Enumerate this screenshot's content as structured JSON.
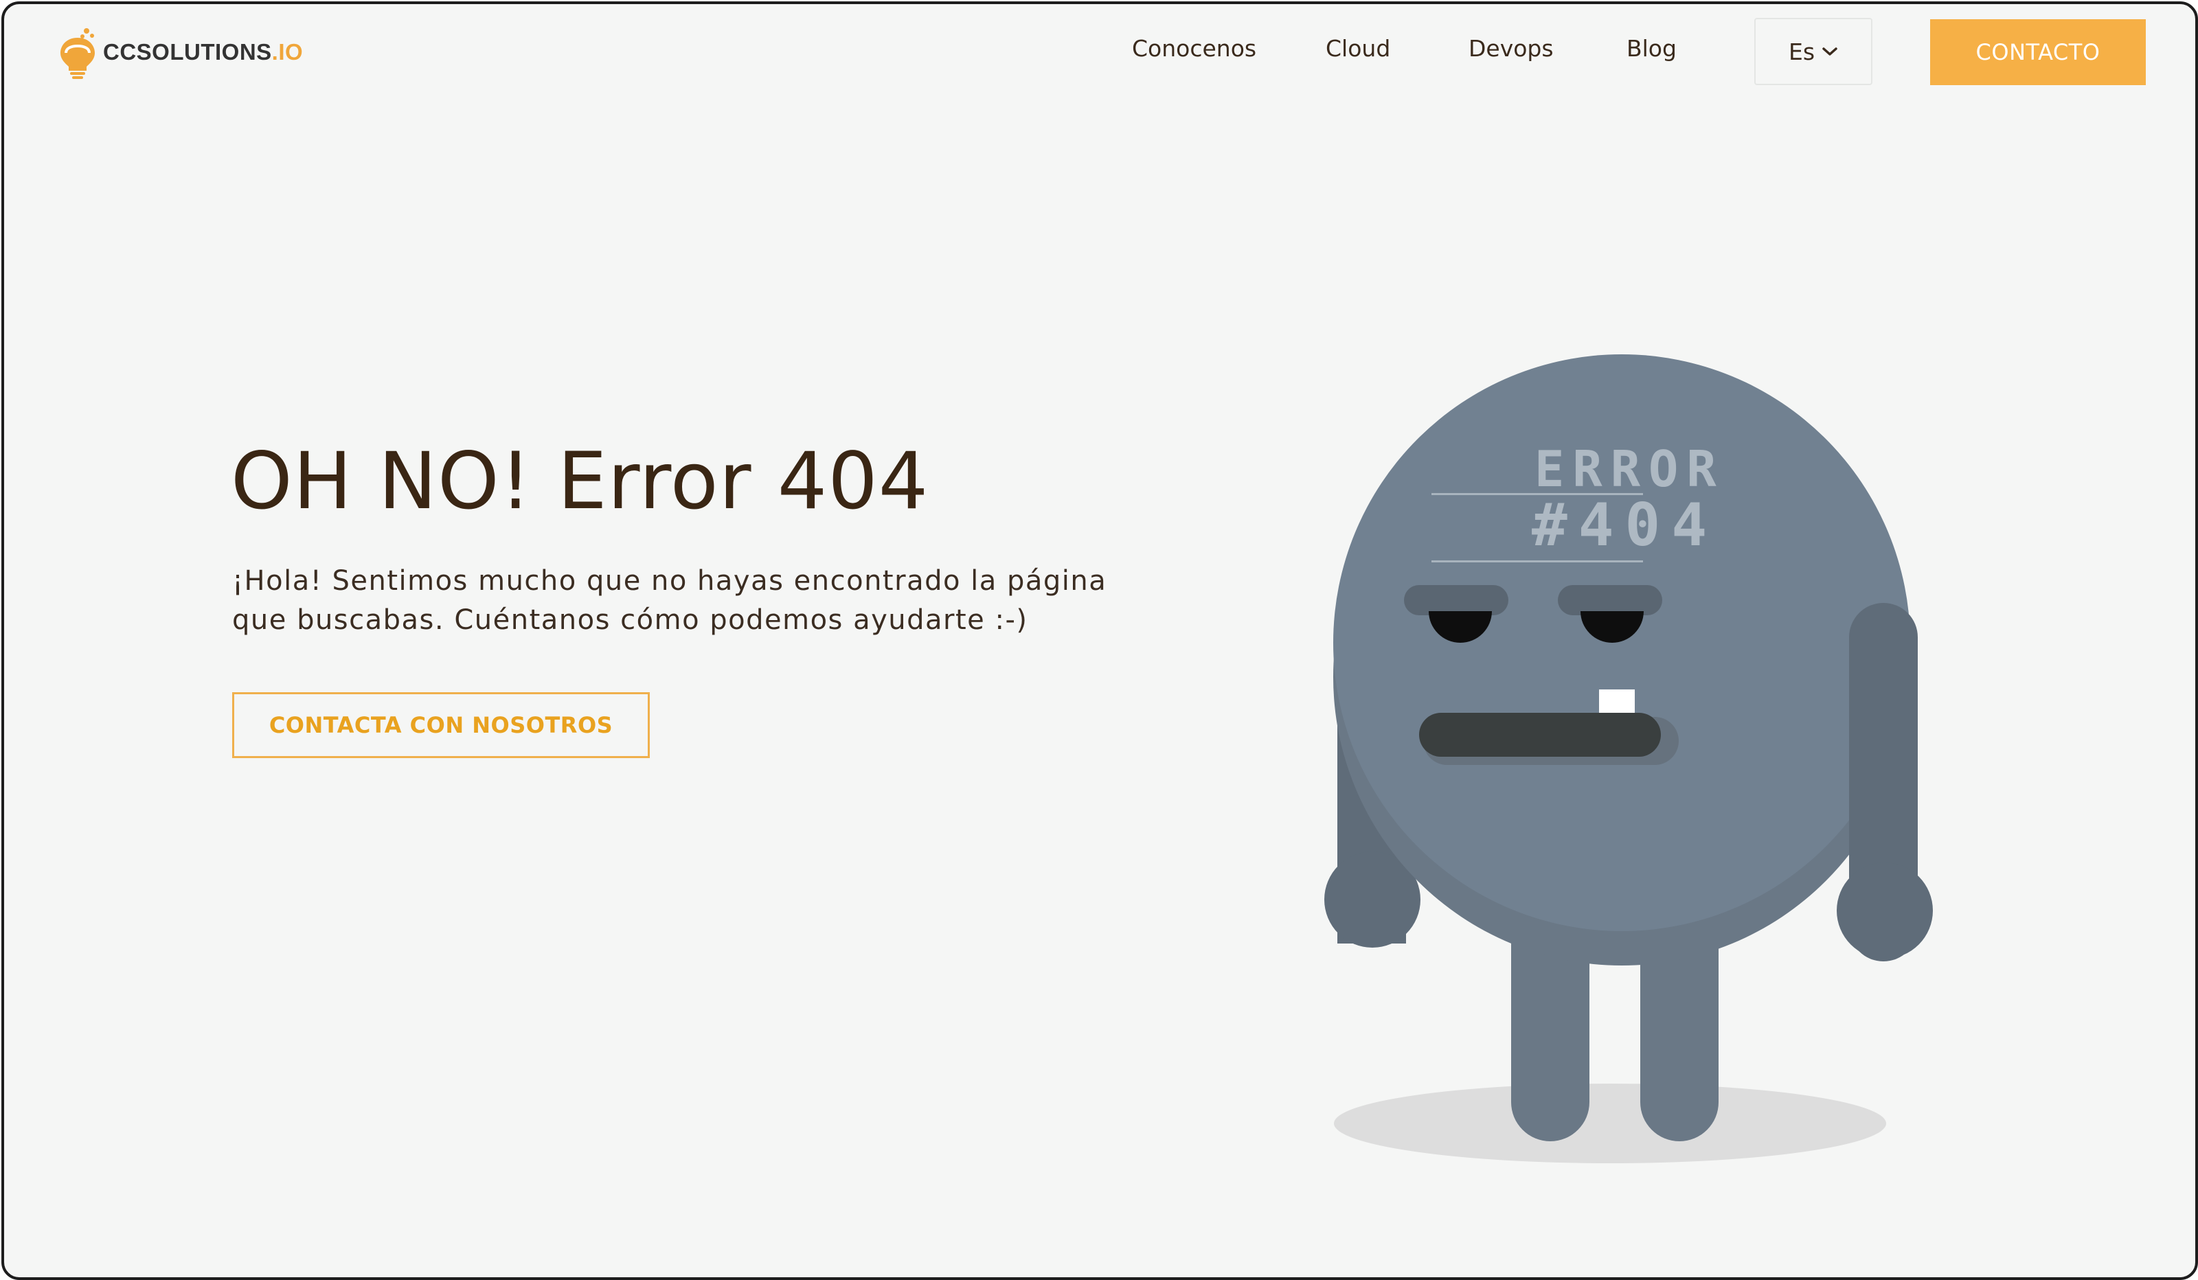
{
  "brand": {
    "name_main": "CCSOLUTIONS",
    "name_suffix": ".IO",
    "accent_color": "#f6b046"
  },
  "nav": {
    "items": [
      {
        "label": "Conocenos"
      },
      {
        "label": "Cloud"
      },
      {
        "label": "Devops"
      },
      {
        "label": "Blog"
      }
    ],
    "language": {
      "selected": "Es",
      "icon": "chevron-down-icon"
    },
    "contact_label": "CONTACTO"
  },
  "hero": {
    "title": "OH NO! Error 404",
    "message": "¡Hola! Sentimos mucho que no hayas encontrado la página que buscabas. Cuéntanos cómo podemos ayudarte :-)",
    "cta_label": "CONTACTA CON NOSOTROS"
  },
  "illustration": {
    "line1": "ERROR",
    "line2": "#404",
    "body_color": "#6f7f8f"
  }
}
